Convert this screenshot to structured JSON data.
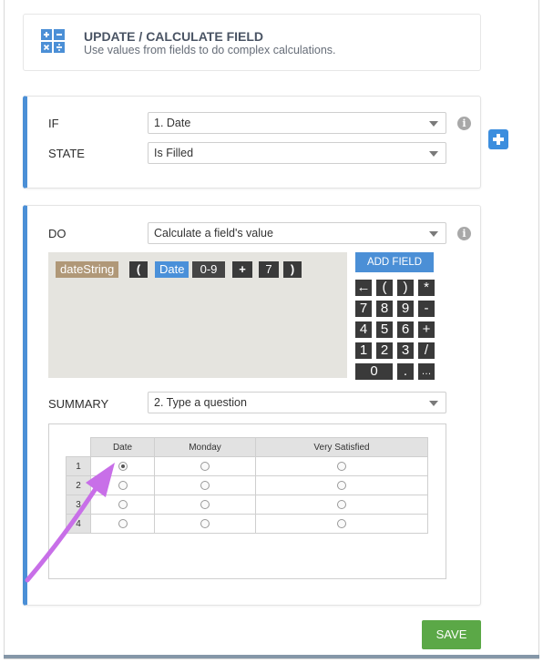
{
  "header": {
    "title": "UPDATE / CALCULATE FIELD",
    "subtitle": "Use values from fields to do complex calculations."
  },
  "condition": {
    "if_label": "IF",
    "if_value": "1. Date",
    "state_label": "STATE",
    "state_value": "Is Filled"
  },
  "action": {
    "do_label": "DO",
    "do_value": "Calculate a field's value",
    "tokens": [
      "dateString",
      "(",
      "Date",
      "0-9",
      "+",
      "7",
      ")"
    ],
    "add_field_label": "ADD FIELD",
    "keypad": [
      "←",
      "(",
      ")",
      "*",
      "7",
      "8",
      "9",
      "-",
      "4",
      "5",
      "6",
      "+",
      "1",
      "2",
      "3",
      "/",
      "0",
      ".",
      "…"
    ],
    "summary_label": "SUMMARY",
    "summary_value": "2. Type a question"
  },
  "grid": {
    "columns": [
      "Date",
      "Monday",
      "Very Satisfied"
    ],
    "rows": [
      "1",
      "2",
      "3",
      "4"
    ],
    "selected": {
      "row": 0,
      "col": 0
    }
  },
  "footer": {
    "save_label": "SAVE"
  },
  "colors": {
    "accent": "#4b8fd6",
    "save": "#5ba847",
    "arrow": "#c86fe8"
  }
}
